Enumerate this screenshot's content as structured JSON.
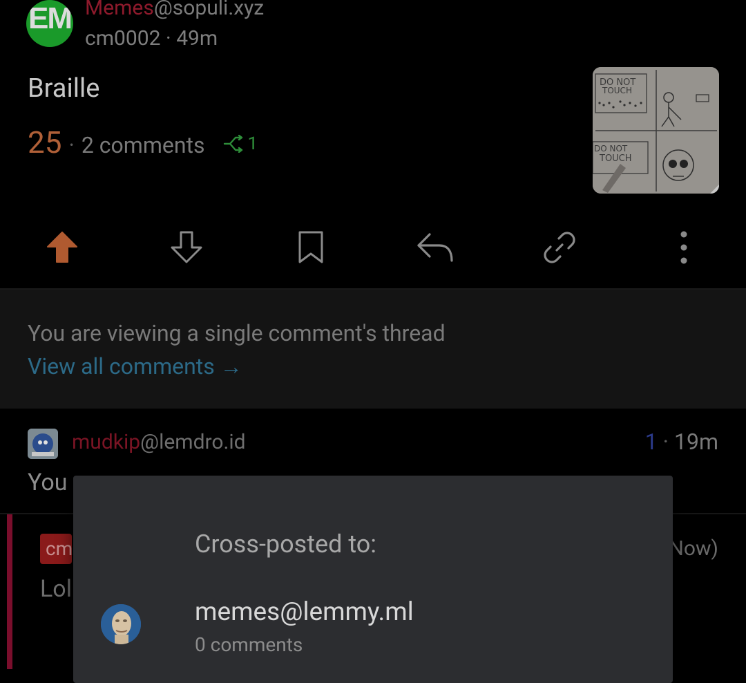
{
  "post": {
    "community_name": "Memes",
    "community_instance": "@sopuli.xyz",
    "author": "cm0002",
    "age": "49m",
    "title": "Braille",
    "score": "25",
    "comments": "2 comments",
    "crosspost_count": "1",
    "thumbnail_text_top": "DO NOT TOUCH",
    "thumbnail_text_bottom": "DO NOT TOUCH"
  },
  "actions": [
    "upvote",
    "downvote",
    "save",
    "reply",
    "copy-link",
    "more"
  ],
  "banner": {
    "notice": "You are viewing a single comment's thread",
    "link": "View all comments →"
  },
  "comment": {
    "user": "mudkip",
    "instance": "@lemdro.id",
    "score": "1",
    "age": "19m",
    "body": "You"
  },
  "reply": {
    "badge": "cm",
    "age_suffix": "Now)",
    "body": "Lol"
  },
  "dialog": {
    "title": "Cross-posted to:",
    "items": [
      {
        "community": "memes@lemmy.ml",
        "comments": "0 comments"
      }
    ]
  },
  "colors": {
    "upvote": "#b05a30",
    "crosspost": "#2e8e3a",
    "link": "#2c6a88",
    "dialog_bg": "#2c2d30"
  }
}
